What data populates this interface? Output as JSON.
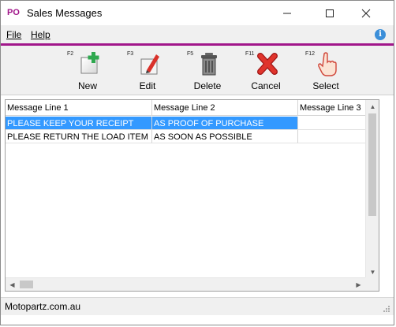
{
  "window": {
    "app_badge": "PO",
    "title": "Sales Messages",
    "accent_color": "#a1168a"
  },
  "menu": {
    "file_label": "File",
    "help_label": "Help",
    "info_icon": "info-icon"
  },
  "toolbar": {
    "new": {
      "fkey": "F2",
      "label": "New",
      "icon": "new-document-icon"
    },
    "edit": {
      "fkey": "F3",
      "label": "Edit",
      "icon": "edit-pencil-icon"
    },
    "delete": {
      "fkey": "F5",
      "label": "Delete",
      "icon": "trash-can-icon"
    },
    "cancel": {
      "fkey": "F11",
      "label": "Cancel",
      "icon": "red-x-icon"
    },
    "select": {
      "fkey": "F12",
      "label": "Select",
      "icon": "hand-pointer-icon"
    }
  },
  "grid": {
    "columns": [
      "Message Line 1",
      "Message Line 2",
      "Message Line 3"
    ],
    "rows": [
      [
        "PLEASE KEEP YOUR RECEIPT",
        "AS PROOF OF PURCHASE",
        ""
      ],
      [
        "PLEASE RETURN THE LOAD ITEM",
        "AS SOON AS POSSIBLE",
        ""
      ]
    ],
    "selected_row": 0,
    "selection_color": "#3399ff"
  },
  "status": {
    "text": "Motopartz.com.au"
  }
}
